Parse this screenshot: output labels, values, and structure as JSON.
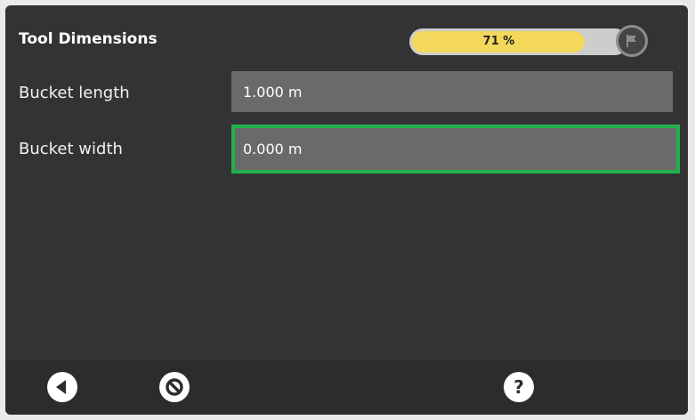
{
  "header": {
    "title": "Tool Dimensions",
    "progress": {
      "value_percent": 71,
      "label": "71 %",
      "fill_color": "#f3d85b",
      "icon": "flag-icon"
    }
  },
  "fields": [
    {
      "label": "Bucket length",
      "value": "1.000 m"
    },
    {
      "label": "Bucket width",
      "value": "0.000 m",
      "focused": true,
      "focus_color": "#22b24c"
    }
  ],
  "bottom_bar": {
    "buttons": [
      {
        "name": "back-button",
        "icon": "back-arrow-icon"
      },
      {
        "name": "cancel-button",
        "icon": "cancel-icon"
      },
      {
        "name": "help-button",
        "icon": "help-icon"
      }
    ]
  }
}
